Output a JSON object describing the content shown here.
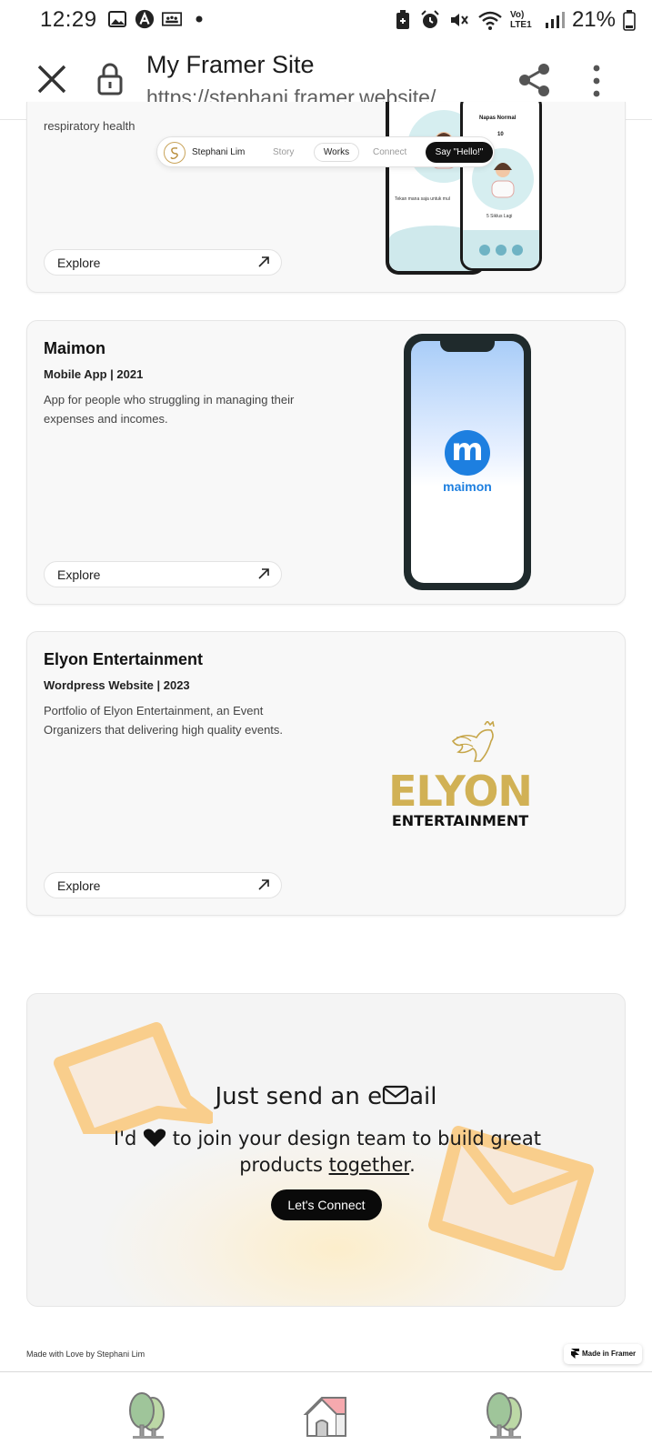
{
  "status_bar": {
    "time": "12:29",
    "battery": "21%",
    "network": "Vo) LTE1"
  },
  "browser": {
    "title": "My Framer Site",
    "url": "https://stephani.framer.website/"
  },
  "nav": {
    "name": "Stephani Lim",
    "items": [
      "Story",
      "Works",
      "Connect"
    ],
    "cta": "Say \"Hello!\""
  },
  "project_top": {
    "desc_tail": "respiratory health",
    "explore_label": "Explore",
    "phone_texts": [
      "Napas Normal",
      "10",
      "5 Siklus Lagi",
      "Tekan mana saja untuk mul"
    ]
  },
  "projects": [
    {
      "title": "Maimon",
      "subtitle": "Mobile App | 2021",
      "description": "App for people who struggling in managing their expenses and incomes.",
      "explore_label": "Explore",
      "app_name": "maimon",
      "app_letter": "m"
    },
    {
      "title": "Elyon Entertainment",
      "subtitle": "Wordpress Website | 2023",
      "description": "Portfolio of Elyon Entertainment, an Event Organizers that delivering high quality events.",
      "explore_label": "Explore",
      "logo_line1": "ELYON",
      "logo_line2": "ENTERTAINMENT"
    }
  ],
  "email": {
    "heading_prefix": "Just send an e",
    "heading_suffix": "ail",
    "line1_a": "I'd",
    "line1_b": "to join your design team to build great",
    "line2_a": "products",
    "line2_b": "together",
    "line2_c": ".",
    "button": "Let's Connect"
  },
  "footer": {
    "credit": "Made with Love by Stephani Lim",
    "badge": "Made in Framer"
  },
  "colors": {
    "gold": "#d1b155",
    "maimon_blue": "#1d7fe0",
    "envelope_orange": "#f9ce8c"
  }
}
